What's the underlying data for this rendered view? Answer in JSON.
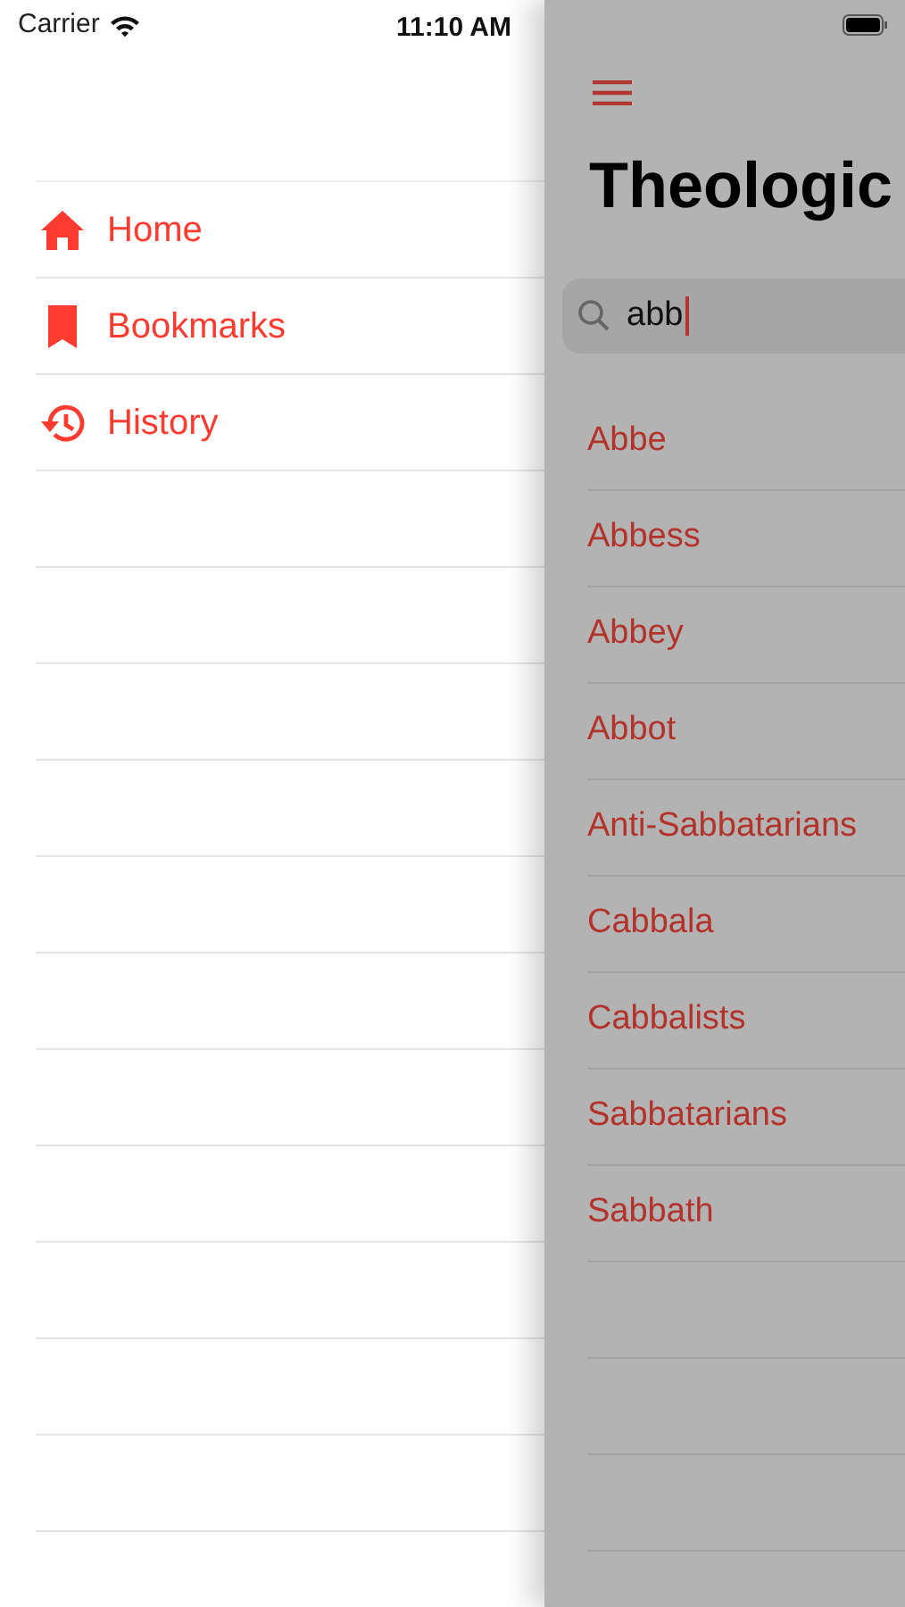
{
  "status_bar": {
    "carrier": "Carrier",
    "time": "11:10 AM"
  },
  "menu": {
    "items": [
      {
        "kind": "home",
        "label": "Home"
      },
      {
        "kind": "bookmark",
        "label": "Bookmarks"
      },
      {
        "kind": "history",
        "label": "History"
      }
    ]
  },
  "main": {
    "title": "Theologic",
    "search": {
      "value": "abb"
    },
    "results": [
      "Abbe",
      "Abbess",
      "Abbey",
      "Abbot",
      "Anti-Sabbatarians",
      "Cabbala",
      "Cabbalists",
      "Sabbatarians",
      "Sabbath"
    ]
  }
}
